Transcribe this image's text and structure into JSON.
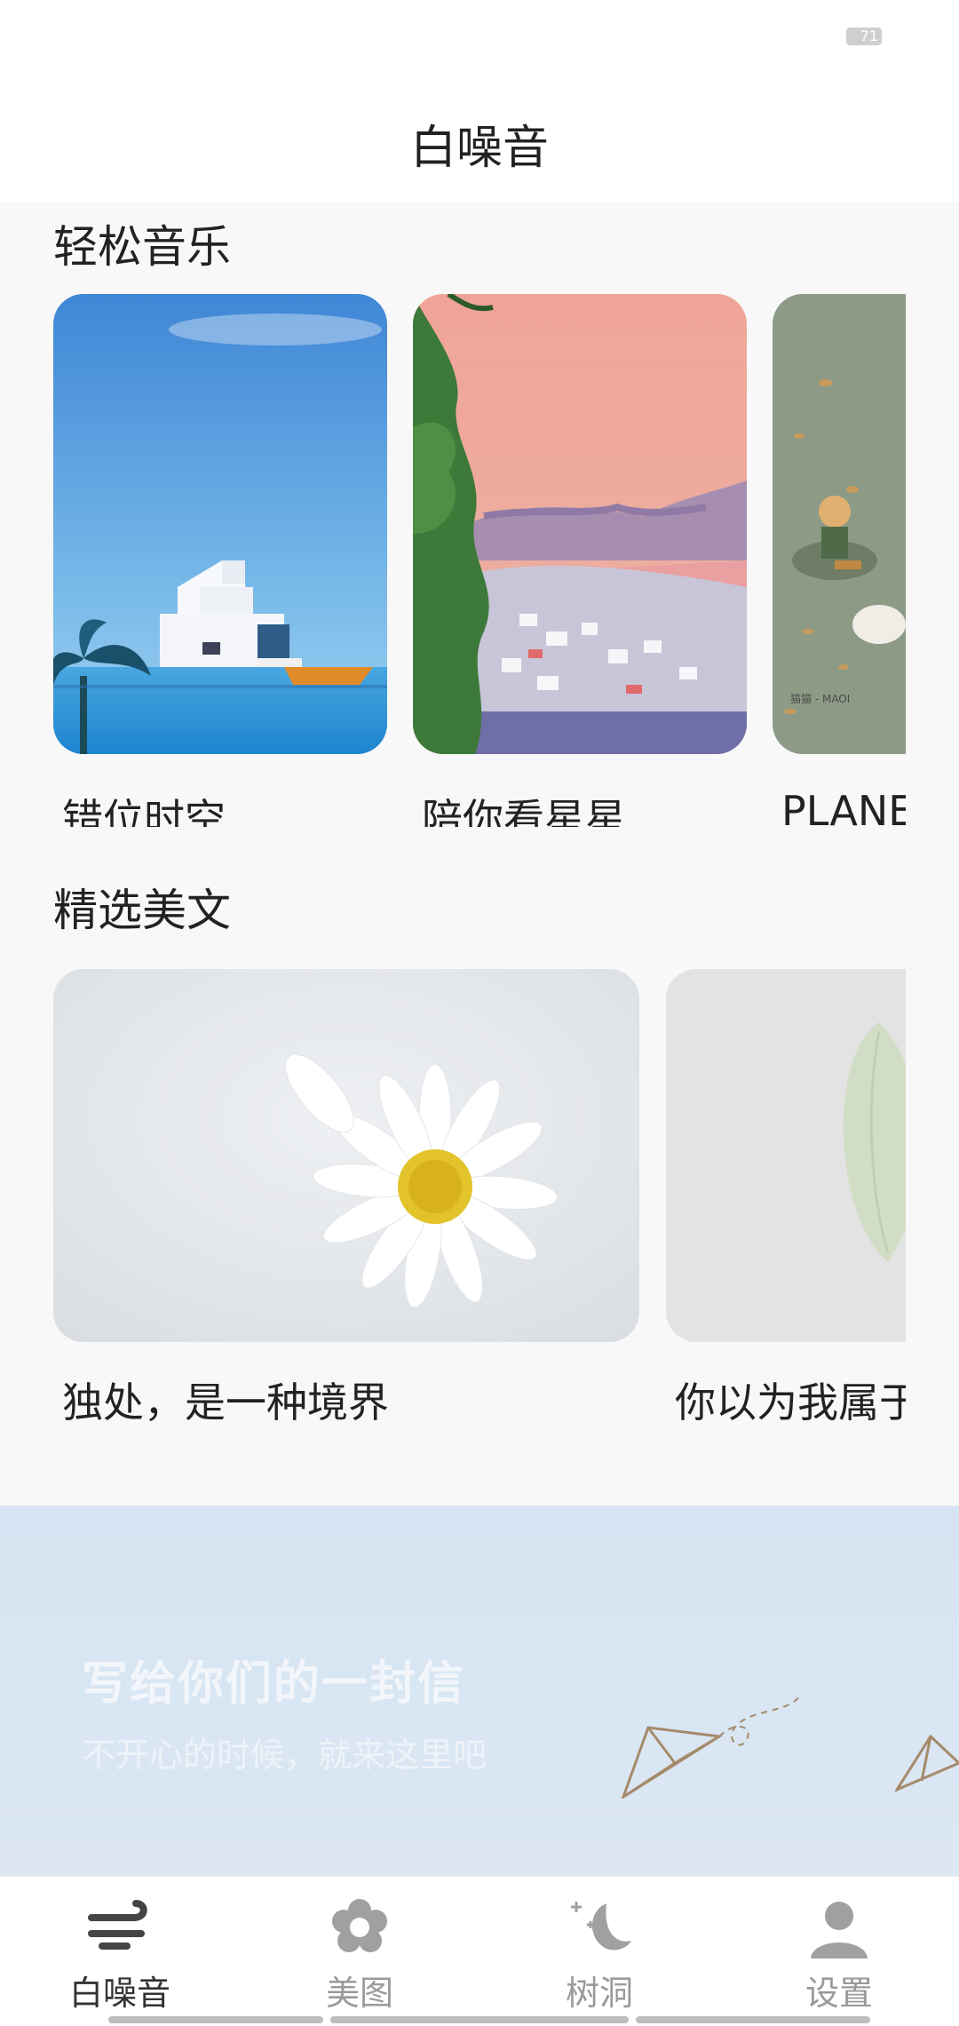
{
  "status_bar": {
    "battery": "71"
  },
  "header": {
    "title": "白噪音"
  },
  "relax_music": {
    "title": "轻松音乐",
    "items": [
      {
        "title": "错位时空",
        "image": "harbor-museum-illustration"
      },
      {
        "title": "陪你看星星",
        "image": "pink-sky-town-illustration"
      },
      {
        "title": "PLANET",
        "image": "girl-with-cat-illustration"
      }
    ]
  },
  "selected_essays": {
    "title": "精选美文",
    "items": [
      {
        "title": "独处，是一种境界",
        "image": "daisy-photo"
      },
      {
        "title": "你以为我属于",
        "image": "leaf-photo"
      }
    ]
  },
  "letter_banner": {
    "title": "写给你们的一封信",
    "subtitle": "不开心的时候，就来这里吧",
    "icon": "paper-plane-icon"
  },
  "tab_bar": {
    "active": "白噪音",
    "tabs": [
      {
        "label": "白噪音",
        "icon": "wind-icon"
      },
      {
        "label": "美图",
        "icon": "flower-icon"
      },
      {
        "label": "树洞",
        "icon": "moon-icon"
      },
      {
        "label": "设置",
        "icon": "person-icon"
      }
    ]
  }
}
